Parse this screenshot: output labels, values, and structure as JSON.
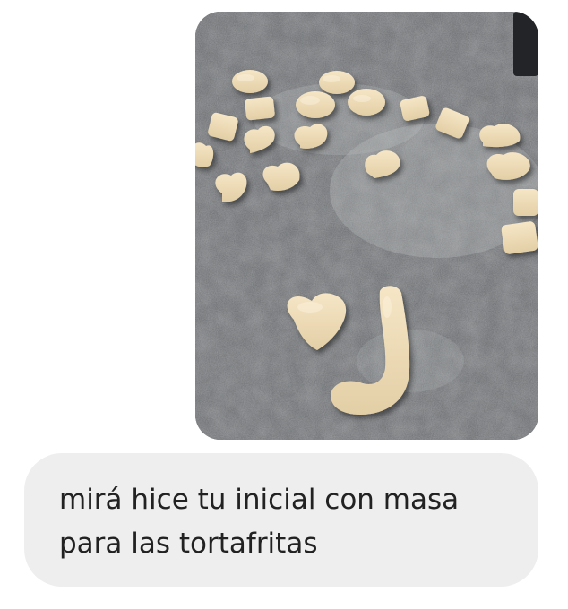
{
  "conversation": {
    "photo_message": {
      "icon": "photo-attachment",
      "content": "dough shapes on countertop"
    },
    "text_message": {
      "text": "mirá hice tu inicial con masa\npara las tortafritas"
    }
  },
  "colors": {
    "background": "#ffffff",
    "bubble": "#eeeeee",
    "text": "#222222",
    "countertop": "#6d6f72",
    "dough": "#f1dfbc"
  }
}
